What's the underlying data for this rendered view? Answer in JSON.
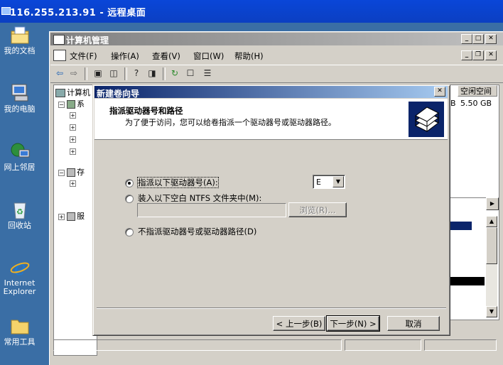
{
  "remote_desktop": {
    "title": "116.255.213.91 - 远程桌面"
  },
  "desktop_icons": [
    {
      "label": "我的文档",
      "icon": "my-documents-icon"
    },
    {
      "label": "我的电脑",
      "icon": "my-computer-icon"
    },
    {
      "label": "网上邻居",
      "icon": "network-places-icon"
    },
    {
      "label": "回收站",
      "icon": "recycle-bin-icon"
    },
    {
      "label": "Internet Explorer",
      "icon": "internet-explorer-icon"
    },
    {
      "label": "常用工具",
      "icon": "folder-icon"
    }
  ],
  "mmc": {
    "title": "计算机管理",
    "menu": [
      "文件(F)",
      "操作(A)",
      "查看(V)",
      "窗口(W)",
      "帮助(H)"
    ],
    "tree": {
      "root": "计算机",
      "items": [
        "系",
        "存",
        "服"
      ]
    },
    "columns": {
      "free_space": "空闲空间"
    },
    "row_values": {
      "b_suffix": "B",
      "free_space": "5.50 GB"
    }
  },
  "wizard": {
    "title": "新建卷向导",
    "header_title": "指派驱动器号和路径",
    "header_subtitle": "为了便于访问，您可以给卷指派一个驱动器号或驱动器路径。",
    "options": [
      {
        "label": "指派以下驱动器号(A):",
        "selected": true
      },
      {
        "label": "装入以下空白 NTFS 文件夹中(M):",
        "selected": false
      },
      {
        "label": "不指派驱动器号或驱动器路径(D)",
        "selected": false
      }
    ],
    "drive_letter": "E",
    "folder_path": "",
    "browse_label": "浏览(R)...",
    "back_label": "< 上一步(B)",
    "next_label": "下一步(N) >",
    "cancel_label": "取消"
  }
}
